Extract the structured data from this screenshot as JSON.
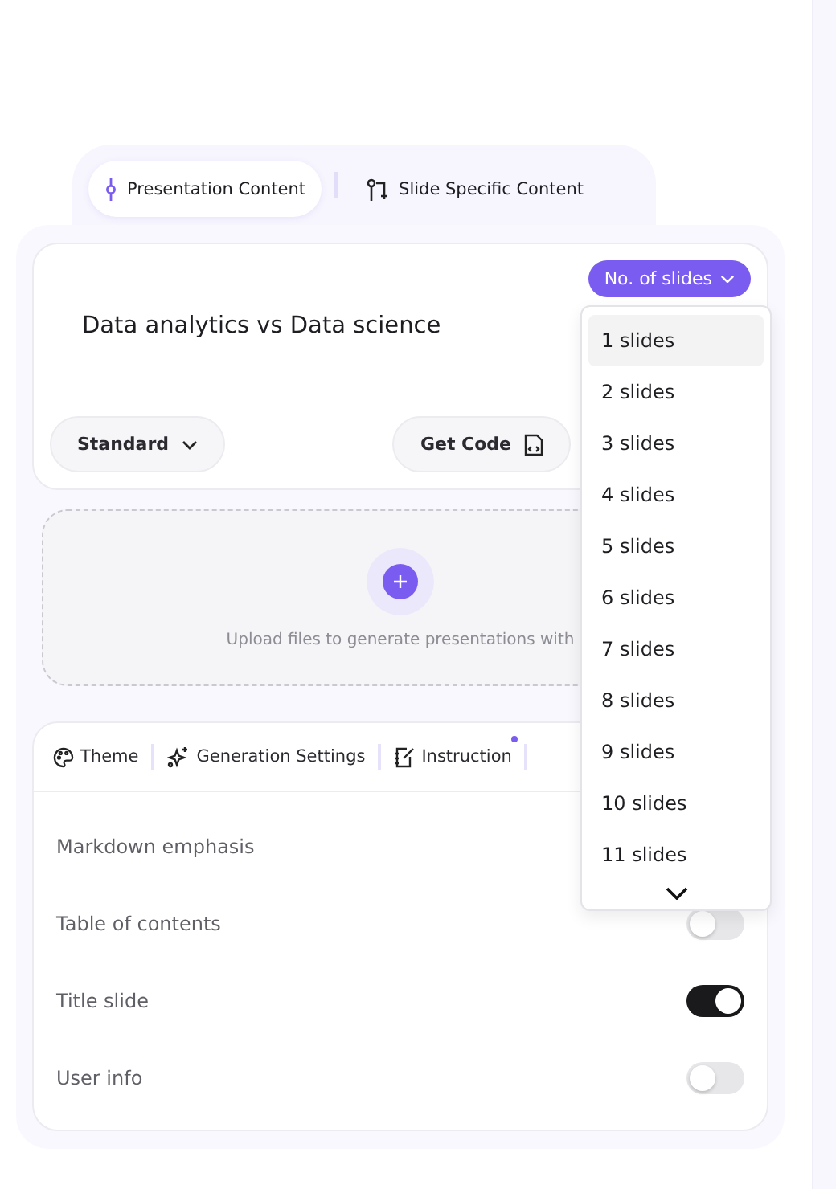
{
  "mode_tabs": [
    {
      "label": "Presentation Content",
      "selected": true
    },
    {
      "label": "Slide Specific Content",
      "selected": false
    }
  ],
  "topic": "Data analytics vs Data science",
  "slides_button": {
    "label": "No. of slides"
  },
  "style_select": {
    "value": "Standard"
  },
  "get_code": {
    "label": "Get Code"
  },
  "upload": {
    "text": "Upload files to generate presentations with"
  },
  "settings_tabs": [
    {
      "label": "Theme",
      "badge": false
    },
    {
      "label": "Generation Settings",
      "badge": false
    },
    {
      "label": "Instruction",
      "badge": true
    }
  ],
  "settings": [
    {
      "label": "Markdown emphasis"
    },
    {
      "label": "Table of contents",
      "on": false
    },
    {
      "label": "Title slide",
      "on": true
    },
    {
      "label": "User info",
      "on": false
    }
  ],
  "slides_menu": {
    "items": [
      {
        "label": "1 slides",
        "selected": true
      },
      {
        "label": "2 slides",
        "selected": false
      },
      {
        "label": "3 slides",
        "selected": false
      },
      {
        "label": "4 slides",
        "selected": false
      },
      {
        "label": "5 slides",
        "selected": false
      },
      {
        "label": "6 slides",
        "selected": false
      },
      {
        "label": "7 slides",
        "selected": false
      },
      {
        "label": "8 slides",
        "selected": false
      },
      {
        "label": "9 slides",
        "selected": false
      },
      {
        "label": "10 slides",
        "selected": false
      },
      {
        "label": "11 slides",
        "selected": false
      }
    ]
  }
}
